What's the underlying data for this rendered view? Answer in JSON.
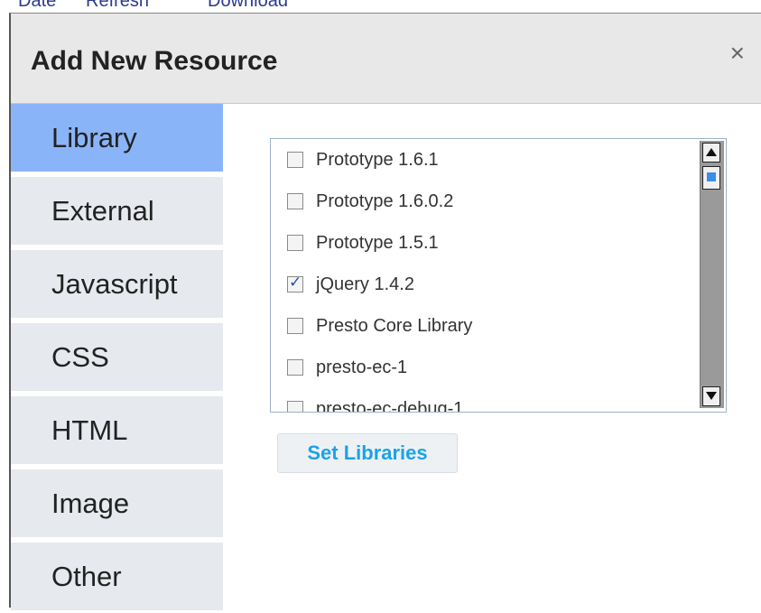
{
  "dialog": {
    "title": "Add New Resource",
    "close_label": "×"
  },
  "sidebar": {
    "items": [
      {
        "label": "Library",
        "active": true
      },
      {
        "label": "External",
        "active": false
      },
      {
        "label": "Javascript",
        "active": false
      },
      {
        "label": "CSS",
        "active": false
      },
      {
        "label": "HTML",
        "active": false
      },
      {
        "label": "Image",
        "active": false
      },
      {
        "label": "Other",
        "active": false
      }
    ]
  },
  "libraries": [
    {
      "label": "Prototype 1.6.1",
      "checked": false
    },
    {
      "label": "Prototype 1.6.0.2",
      "checked": false
    },
    {
      "label": "Prototype 1.5.1",
      "checked": false
    },
    {
      "label": "jQuery 1.4.2",
      "checked": true
    },
    {
      "label": "Presto Core Library",
      "checked": false
    },
    {
      "label": "presto-ec-1",
      "checked": false
    },
    {
      "label": "presto-ec-debug-1",
      "checked": false
    }
  ],
  "actions": {
    "set_libraries_label": "Set Libraries"
  },
  "colors": {
    "active_tab": "#8ab4f8",
    "button_text": "#1aa3e8"
  }
}
